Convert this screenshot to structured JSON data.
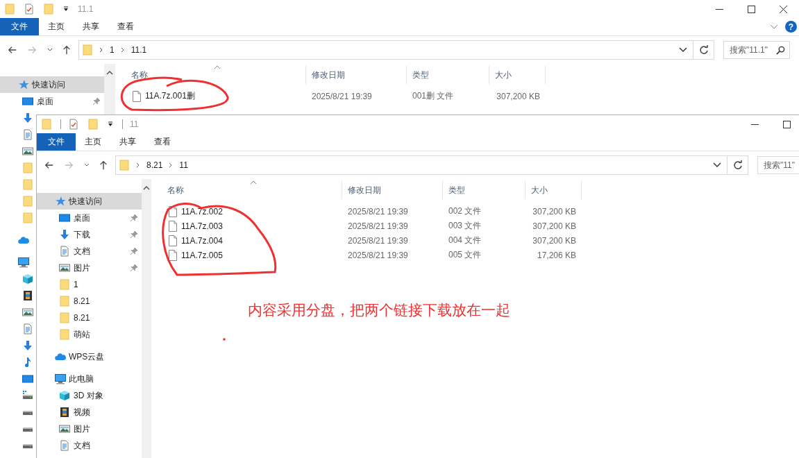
{
  "back_window": {
    "title": "11.1",
    "ribbon": [
      {
        "label": "文件",
        "kind": "file"
      },
      {
        "label": "主页",
        "kind": "tab"
      },
      {
        "label": "共享",
        "kind": "tab"
      },
      {
        "label": "查看",
        "kind": "tab"
      }
    ],
    "help": "?",
    "path": [
      "1",
      "11.1"
    ],
    "search": {
      "placeholder": "搜索\"11.1\""
    },
    "sidebar": [
      {
        "label": "快速访问",
        "kind": "quick",
        "selected": true,
        "children": [
          {
            "label": "桌面",
            "kind": "desktop",
            "pinned": true,
            "selected": false
          },
          {
            "kind": "download",
            "selected": false
          },
          {
            "kind": "document",
            "selected": false
          },
          {
            "kind": "picture",
            "selected": false
          },
          {
            "kind": "folder",
            "selected": false
          },
          {
            "kind": "folder",
            "selected": false
          },
          {
            "kind": "folder",
            "selected": false
          },
          {
            "kind": "folder",
            "selected": false
          }
        ]
      },
      {
        "kind": "cloud",
        "selected": false
      },
      {
        "kind": "computer",
        "selected": false,
        "children": [
          {
            "kind": "cube",
            "selected": false
          },
          {
            "kind": "video",
            "selected": false
          },
          {
            "kind": "picture",
            "selected": false
          },
          {
            "kind": "document",
            "selected": false
          },
          {
            "kind": "download",
            "selected": false
          },
          {
            "kind": "music",
            "selected": false
          },
          {
            "kind": "desktop",
            "selected": false
          },
          {
            "kind": "netdrive",
            "selected": false
          },
          {
            "kind": "drive",
            "selected": false
          },
          {
            "kind": "drive",
            "selected": false
          },
          {
            "kind": "drive",
            "selected": false
          }
        ]
      }
    ],
    "columns": [
      "名称",
      "修改日期",
      "类型",
      "大小"
    ],
    "files": [
      {
        "name": "11A.7z.001删",
        "date": "2025/8/21 19:39",
        "type": "001删 文件",
        "size": "307,200 KB"
      }
    ]
  },
  "front_window": {
    "title": "11",
    "ribbon": [
      {
        "label": "文件",
        "kind": "file"
      },
      {
        "label": "主页",
        "kind": "tab"
      },
      {
        "label": "共享",
        "kind": "tab"
      },
      {
        "label": "查看",
        "kind": "tab"
      }
    ],
    "path": [
      "8.21",
      "11"
    ],
    "search": {
      "placeholder": "搜索\"11\""
    },
    "sidebar": [
      {
        "label": "快速访问",
        "kind": "quick",
        "selected": true,
        "children": [
          {
            "label": "桌面",
            "kind": "desktop",
            "pinned": true,
            "selected": false
          },
          {
            "label": "下载",
            "kind": "download",
            "pinned": true,
            "selected": false
          },
          {
            "label": "文档",
            "kind": "document",
            "pinned": true,
            "selected": false
          },
          {
            "label": "图片",
            "kind": "picture",
            "pinned": true,
            "selected": false
          },
          {
            "label": "1",
            "kind": "folder",
            "pinned": false,
            "selected": false
          },
          {
            "label": "8.21",
            "kind": "folder",
            "pinned": false,
            "selected": false
          },
          {
            "label": "8.21",
            "kind": "folder",
            "pinned": false,
            "selected": false
          },
          {
            "label": "萌站",
            "kind": "folder",
            "pinned": false,
            "selected": false
          }
        ]
      },
      {
        "label": "WPS云盘",
        "kind": "cloud",
        "selected": false
      },
      {
        "label": "此电脑",
        "kind": "computer",
        "selected": false,
        "children": [
          {
            "label": "3D 对象",
            "kind": "cube",
            "pinned": false,
            "selected": false
          },
          {
            "label": "视频",
            "kind": "video",
            "pinned": false,
            "selected": false
          },
          {
            "label": "图片",
            "kind": "picture",
            "pinned": false,
            "selected": false
          },
          {
            "label": "文档",
            "kind": "document",
            "pinned": false,
            "selected": false
          }
        ]
      }
    ],
    "columns": [
      "名称",
      "修改日期",
      "类型",
      "大小"
    ],
    "files": [
      {
        "name": "11A.7z.002",
        "date": "2025/8/21 19:39",
        "type": "002 文件",
        "size": "307,200 KB"
      },
      {
        "name": "11A.7z.003",
        "date": "2025/8/21 19:39",
        "type": "003 文件",
        "size": "307,200 KB"
      },
      {
        "name": "11A.7z.004",
        "date": "2025/8/21 19:39",
        "type": "004 文件",
        "size": "307,200 KB"
      },
      {
        "name": "11A.7z.005",
        "date": "2025/8/21 19:39",
        "type": "005 文件",
        "size": "17,206 KB"
      }
    ]
  },
  "annotation": {
    "text": "内容采用分盘，把两个链接下载放在一起"
  }
}
